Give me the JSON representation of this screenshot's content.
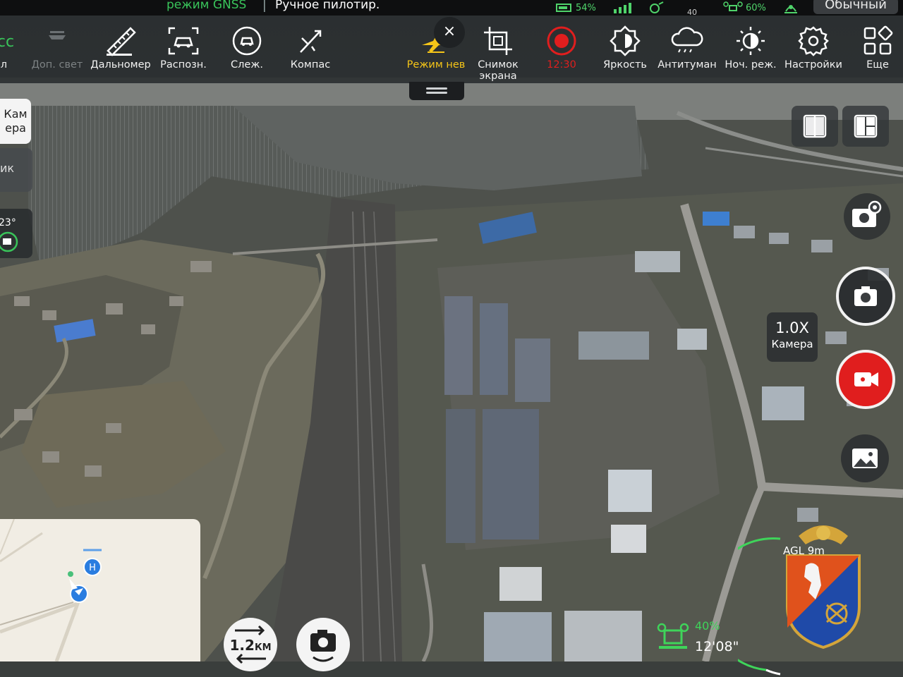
{
  "status_bar": {
    "gnss_mode": "режим GNSS",
    "separator": "|",
    "pilot_mode": "Ручное пилотир.",
    "rc_battery": "54%",
    "gps_count": "40",
    "drone_battery": "60%",
    "profile": "Обычный"
  },
  "toolbar": {
    "items": [
      {
        "id": "partial-left",
        "label": "л",
        "icon": "cc-icon"
      },
      {
        "id": "aux-light",
        "label": "Доп. свет",
        "icon": "aux-light-icon",
        "state": "disabled"
      },
      {
        "id": "rangefinder",
        "label": "Дальномер",
        "icon": "ruler-icon"
      },
      {
        "id": "recognition",
        "label": "Распозн.",
        "icon": "vehicle-recognition-icon"
      },
      {
        "id": "tracking",
        "label": "Слеж.",
        "icon": "tracking-icon"
      },
      {
        "id": "compass",
        "label": "Компас",
        "icon": "compass-icon"
      },
      {
        "id": "sky-mode",
        "label": "Режим нев",
        "icon": "airplane-icon",
        "state": "active"
      },
      {
        "id": "screenshot",
        "label": "Снимок экрана",
        "icon": "crop-icon"
      },
      {
        "id": "record",
        "label": "12:30",
        "icon": "record-icon",
        "state": "recording"
      },
      {
        "id": "brightness",
        "label": "Яркость",
        "icon": "brightness-icon"
      },
      {
        "id": "defog",
        "label": "Антитуман",
        "icon": "defog-icon"
      },
      {
        "id": "night",
        "label": "Ноч. реж.",
        "icon": "night-mode-icon"
      },
      {
        "id": "settings",
        "label": "Настройки",
        "icon": "gear-icon"
      },
      {
        "id": "more",
        "label": "Еще",
        "icon": "grid-icon"
      }
    ],
    "close_label": "×"
  },
  "left_panel": {
    "camera_tab": "Камера",
    "second_tab": "ик",
    "gimbal_angle": "23°"
  },
  "right_panel": {
    "zoom_value": "1.0X",
    "zoom_label": "Камера"
  },
  "bottom": {
    "distance": "1.2",
    "distance_unit": "КМ",
    "battery": "40%",
    "flight_time": "12'08\"",
    "agl": "AGL 9m"
  },
  "colors": {
    "accent_green": "#39c45a",
    "active_yellow": "#f5c518",
    "record_red": "#e01e1e"
  }
}
